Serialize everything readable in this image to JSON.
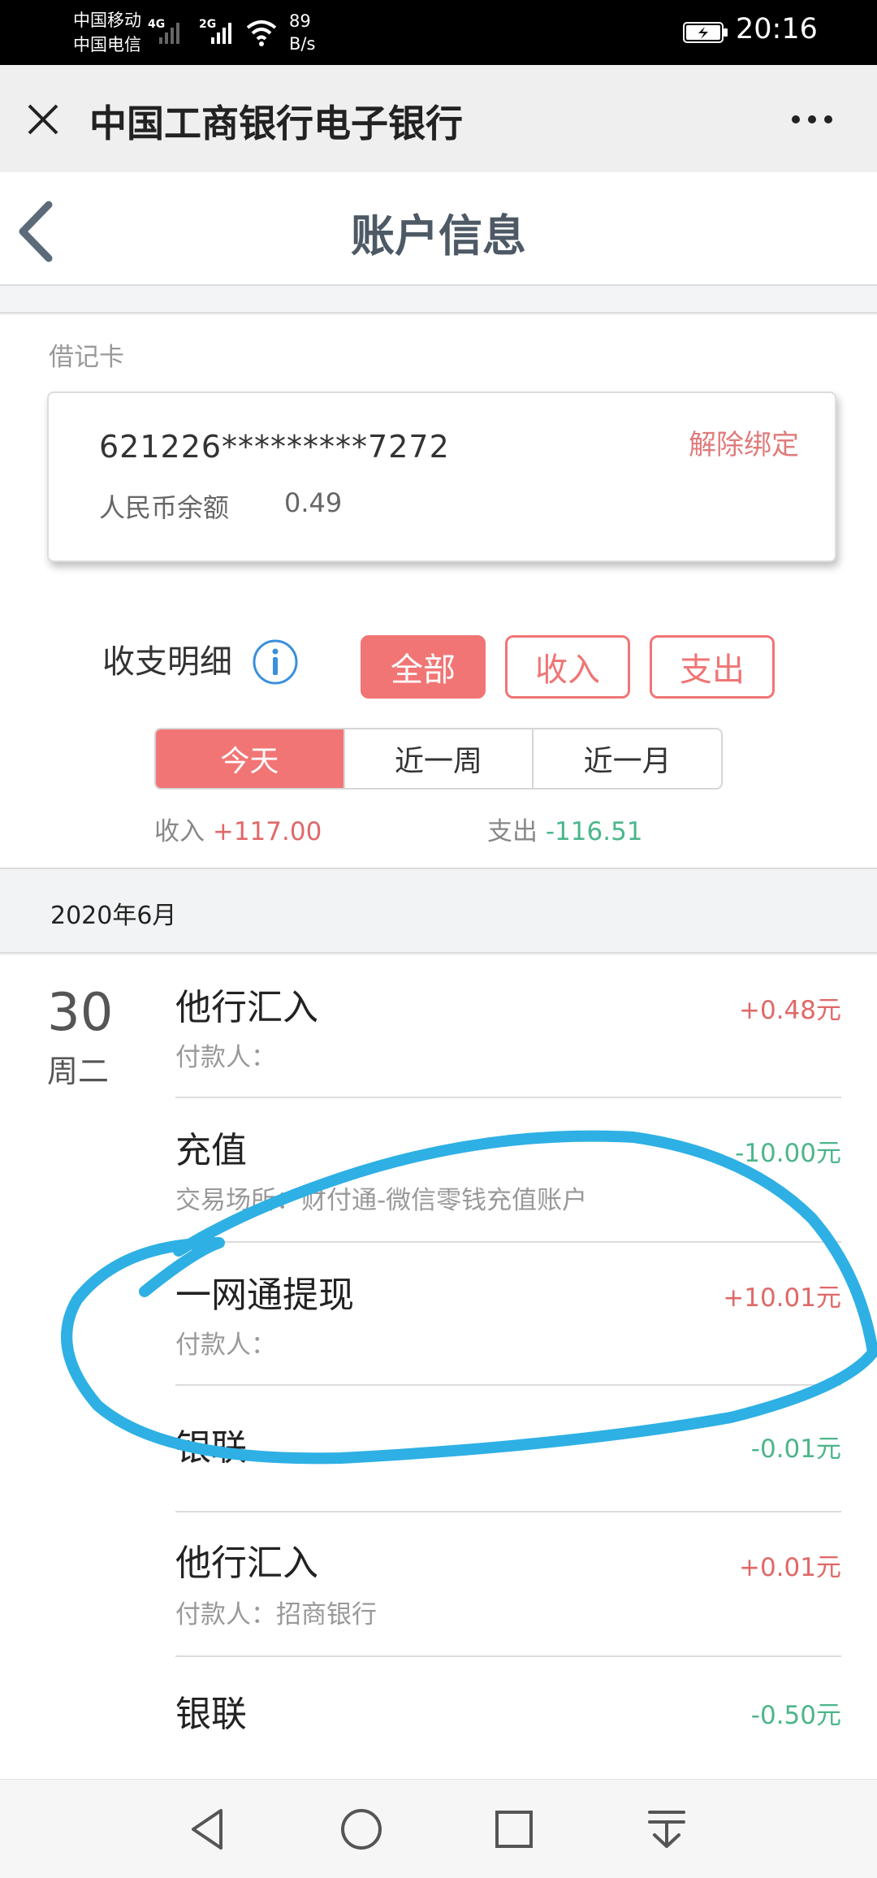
{
  "status_bar": {
    "carrier_1": "中国移动",
    "carrier_2": "中国电信",
    "net_1": "4G",
    "net_2": "2G",
    "speed_value": "89",
    "speed_unit": "B/s",
    "time": "20:16"
  },
  "webview": {
    "title": "中国工商银行电子银行",
    "close_icon": "close-icon",
    "more_icon": "more-dots-icon"
  },
  "header": {
    "title": "账户信息",
    "back_icon": "back-chevron-icon"
  },
  "card": {
    "type_label": "借记卡",
    "number": "621226*********7272",
    "unbind_label": "解除绑定",
    "balance_label": "人民币余额",
    "balance_value": "0.49"
  },
  "details": {
    "label": "收支明细",
    "info_icon": "info-icon",
    "filters": [
      "全部",
      "收入",
      "支出"
    ],
    "active_filter": "全部",
    "periods": [
      "今天",
      "近一周",
      "近一月"
    ],
    "active_period": "今天",
    "income_label": "收入",
    "income_value": "+117.00",
    "expense_label": "支出",
    "expense_value": "-116.51"
  },
  "month": "2020年6月",
  "day": {
    "date": "30",
    "weekday": "周二"
  },
  "transactions": [
    {
      "title": "他行汇入",
      "sub": "付款人：",
      "amount": "+0.48元",
      "sign": "pos"
    },
    {
      "title": "充值",
      "sub": "交易场所：财付通-微信零钱充值账户",
      "amount": "-10.00元",
      "sign": "neg"
    },
    {
      "title": "一网通提现",
      "sub": "付款人：",
      "amount": "+10.01元",
      "sign": "pos"
    },
    {
      "title": "银联",
      "sub": "",
      "amount": "-0.01元",
      "sign": "neg"
    },
    {
      "title": "他行汇入",
      "sub": "付款人：招商银行",
      "amount": "+0.01元",
      "sign": "pos"
    },
    {
      "title": "银联",
      "sub": "",
      "amount": "-0.50元",
      "sign": "neg"
    }
  ],
  "colors": {
    "accent": "#f27575",
    "positive": "#e06868",
    "negative": "#4cb68b",
    "annotation": "#2eb0e4"
  },
  "nav": {
    "back": "nav-back-icon",
    "home": "nav-home-icon",
    "recents": "nav-recents-icon",
    "notifications": "nav-pulldown-icon"
  }
}
